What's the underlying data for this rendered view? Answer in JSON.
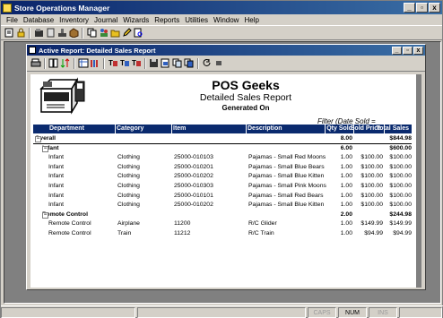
{
  "app": {
    "title": "Store Operations Manager",
    "window_buttons": [
      "_",
      "▫",
      "x"
    ]
  },
  "menu": [
    "File",
    "Database",
    "Inventory",
    "Journal",
    "Wizards",
    "Reports",
    "Utilities",
    "Window",
    "Help"
  ],
  "toolbar_icons": [
    "new-icon",
    "lock-icon",
    "open-icon",
    "document-icon",
    "stamp-icon",
    "box-icon",
    "copy-icon",
    "people-icon",
    "folder-icon",
    "pencil-icon",
    "find-icon"
  ],
  "child": {
    "title": "Active Report: Detailed Sales Report",
    "window_buttons": [
      "_",
      "▫",
      "x"
    ]
  },
  "report_toolbar_icons": [
    "print-icon",
    "columns-icon",
    "sort-icon",
    "grid-icon",
    "bars-icon",
    "font-color-icon",
    "filter-icon",
    "sum-icon",
    "save-icon",
    "export-icon",
    "copy-icon",
    "paste-icon",
    "refresh-icon",
    "stop-icon"
  ],
  "report": {
    "company": "POS Geeks",
    "title": "Detailed Sales Report",
    "generated_on": "Generated On",
    "filter": "Filter (Date Sold  =",
    "columns": {
      "department": "Department",
      "category": "Category",
      "item": "Item",
      "description": "Description",
      "qty_sold": "Qty Sold",
      "sold_price": "Sold Price",
      "total_sales": "Total Sales"
    },
    "rows": [
      {
        "type": "group",
        "level": 0,
        "expander": "−",
        "dept": "Overall",
        "qty": "8.00",
        "total": "$844.98"
      },
      {
        "type": "group",
        "level": 1,
        "expander": "−",
        "dept": "Infant",
        "qty": "6.00",
        "total": "$600.00"
      },
      {
        "type": "detail",
        "dept": "Infant",
        "category": "Clothing",
        "item": "25000-010103",
        "description": "Pajamas - Small Red Moons",
        "qty": "1.00",
        "price": "$100.00",
        "total": "$100.00"
      },
      {
        "type": "detail",
        "dept": "Infant",
        "category": "Clothing",
        "item": "25000-010201",
        "description": "Pajamas - Small Blue Bears",
        "qty": "1.00",
        "price": "$100.00",
        "total": "$100.00"
      },
      {
        "type": "detail",
        "dept": "Infant",
        "category": "Clothing",
        "item": "25000-010202",
        "description": "Pajamas - Small Blue Kitten",
        "qty": "1.00",
        "price": "$100.00",
        "total": "$100.00"
      },
      {
        "type": "detail",
        "dept": "Infant",
        "category": "Clothing",
        "item": "25000-010303",
        "description": "Pajamas - Small Pink Moons",
        "qty": "1.00",
        "price": "$100.00",
        "total": "$100.00"
      },
      {
        "type": "detail",
        "dept": "Infant",
        "category": "Clothing",
        "item": "25000-010101",
        "description": "Pajamas - Small Red Bears",
        "qty": "1.00",
        "price": "$100.00",
        "total": "$100.00"
      },
      {
        "type": "detail",
        "dept": "Infant",
        "category": "Clothing",
        "item": "25000-010202",
        "description": "Pajamas - Small Blue Kitten",
        "qty": "1.00",
        "price": "$100.00",
        "total": "$100.00"
      },
      {
        "type": "group",
        "level": 1,
        "expander": "−",
        "dept": "Remote Control",
        "qty": "2.00",
        "total": "$244.98"
      },
      {
        "type": "detail",
        "dept": "Remote Control",
        "category": "Airplane",
        "item": "11200",
        "description": "R/C Glider",
        "qty": "1.00",
        "price": "$149.99",
        "total": "$149.99"
      },
      {
        "type": "detail",
        "dept": "Remote Control",
        "category": "Train",
        "item": "11212",
        "description": "R/C Train",
        "qty": "1.00",
        "price": "$94.99",
        "total": "$94.99"
      }
    ]
  },
  "status": {
    "caps": "CAPS",
    "num": "NUM",
    "ins": "INS"
  },
  "colors": {
    "titlebar": "#0a246a",
    "header_band": "#0a2a6e",
    "chrome": "#d4d0c8"
  }
}
